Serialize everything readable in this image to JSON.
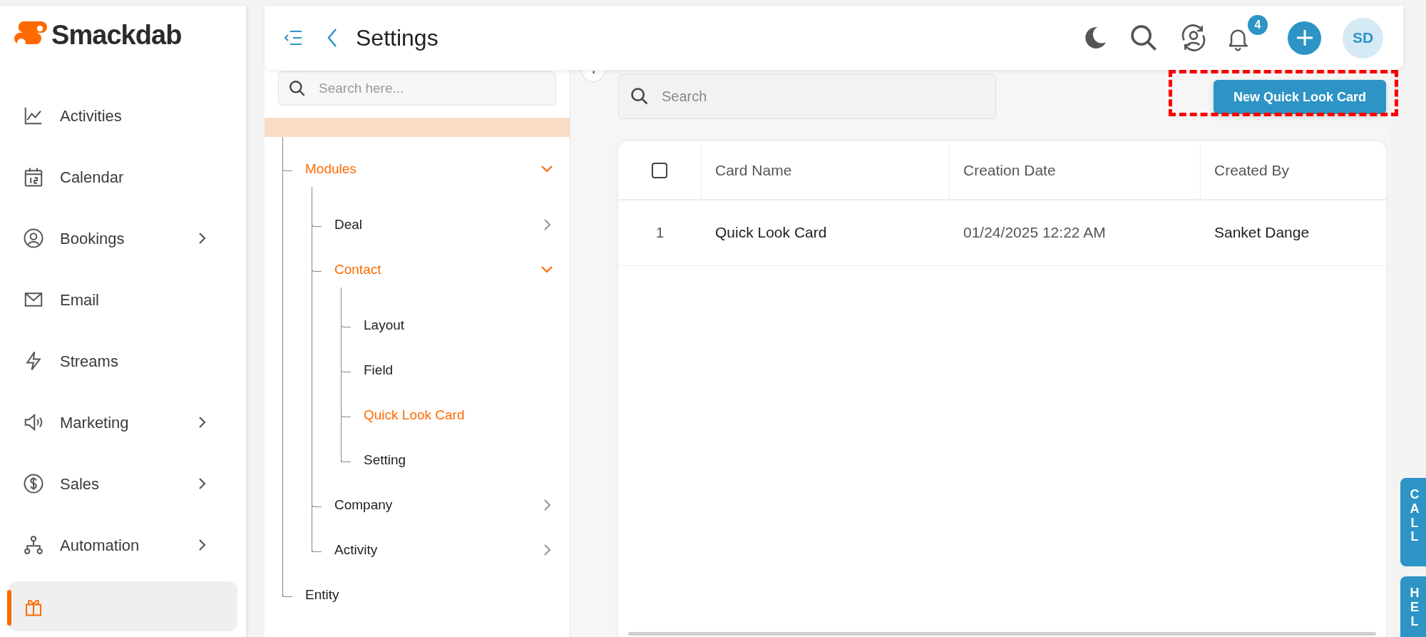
{
  "brand": {
    "name": "Smackdab"
  },
  "sidebar": {
    "items": [
      {
        "label": "Activities",
        "has_submenu": false,
        "selected": false
      },
      {
        "label": "Calendar",
        "has_submenu": false,
        "selected": false
      },
      {
        "label": "Bookings",
        "has_submenu": true,
        "selected": false
      },
      {
        "label": "Email",
        "has_submenu": false,
        "selected": false
      },
      {
        "label": "Streams",
        "has_submenu": false,
        "selected": false
      },
      {
        "label": "Marketing",
        "has_submenu": true,
        "selected": false
      },
      {
        "label": "Sales",
        "has_submenu": true,
        "selected": false
      },
      {
        "label": "Automation",
        "has_submenu": true,
        "selected": false
      },
      {
        "has_submenu": false,
        "selected": true
      }
    ]
  },
  "header": {
    "title": "Settings",
    "notifications": "4",
    "avatar": "SD"
  },
  "settings_tree": {
    "search": {
      "placeholder": "Search here..."
    },
    "items": [
      {
        "label": "Modules",
        "expanded": true,
        "selected": true,
        "children": [
          {
            "label": "Deal",
            "expanded": false,
            "selected": false
          },
          {
            "label": "Contact",
            "expanded": true,
            "selected": true,
            "children": [
              {
                "label": "Layout",
                "selected": false
              },
              {
                "label": "Field",
                "selected": false
              },
              {
                "label": "Quick Look Card",
                "selected": true
              },
              {
                "label": "Setting",
                "selected": false
              }
            ]
          },
          {
            "label": "Company",
            "expanded": false,
            "selected": false
          },
          {
            "label": "Activity",
            "expanded": false,
            "selected": false
          }
        ]
      },
      {
        "label": "Entity",
        "selected": false
      }
    ]
  },
  "content": {
    "search": {
      "placeholder": "Search"
    },
    "new_button": {
      "label": "New Quick Look Card",
      "highlighted": true
    },
    "table": {
      "select_all": {
        "checked": false
      },
      "columns": [
        "Card Name",
        "Creation Date",
        "Created By"
      ],
      "rows": [
        {
          "index": "1",
          "cells": [
            "Quick Look Card",
            "01/24/2025 12:22 AM",
            "Sanket Dange"
          ]
        }
      ]
    }
  },
  "side_tabs": [
    "CALL",
    "HEL"
  ]
}
